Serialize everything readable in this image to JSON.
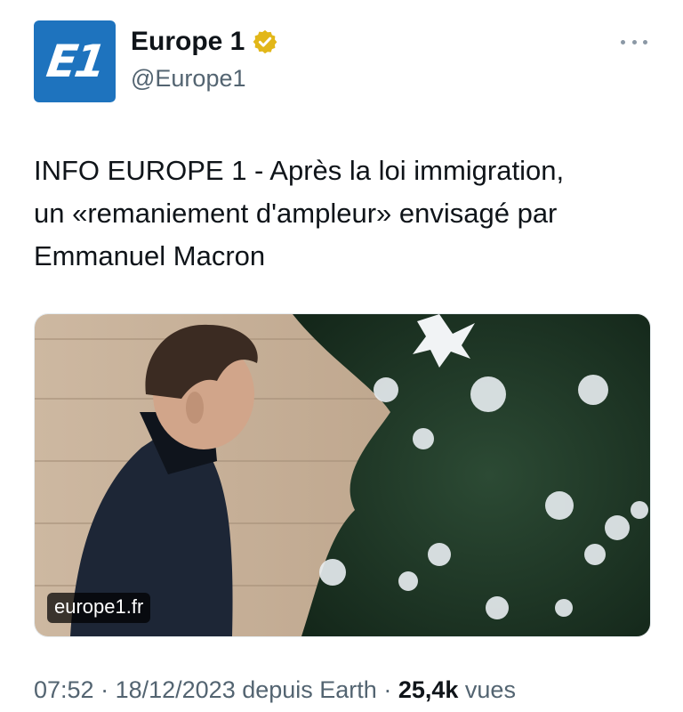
{
  "account": {
    "name": "Europe 1",
    "handle": "@Europe1",
    "avatar_text": "E1",
    "avatar_color": "#1e73be",
    "verified_badge": "gold-verified-badge-icon"
  },
  "menu": {
    "icon": "more-icon"
  },
  "tweet": {
    "lines": [
      "INFO EUROPE 1 - Après la loi immigration,",
      "un «remaniement d'ampleur» envisagé par",
      "Emmanuel Macron"
    ]
  },
  "media": {
    "domain": "europe1.fr"
  },
  "meta": {
    "time": "07:52",
    "sep1": " · ",
    "date": "18/12/2023",
    "source": " depuis Earth",
    "sep2": " · ",
    "views_count": "25,4k",
    "views_label": " vues"
  }
}
